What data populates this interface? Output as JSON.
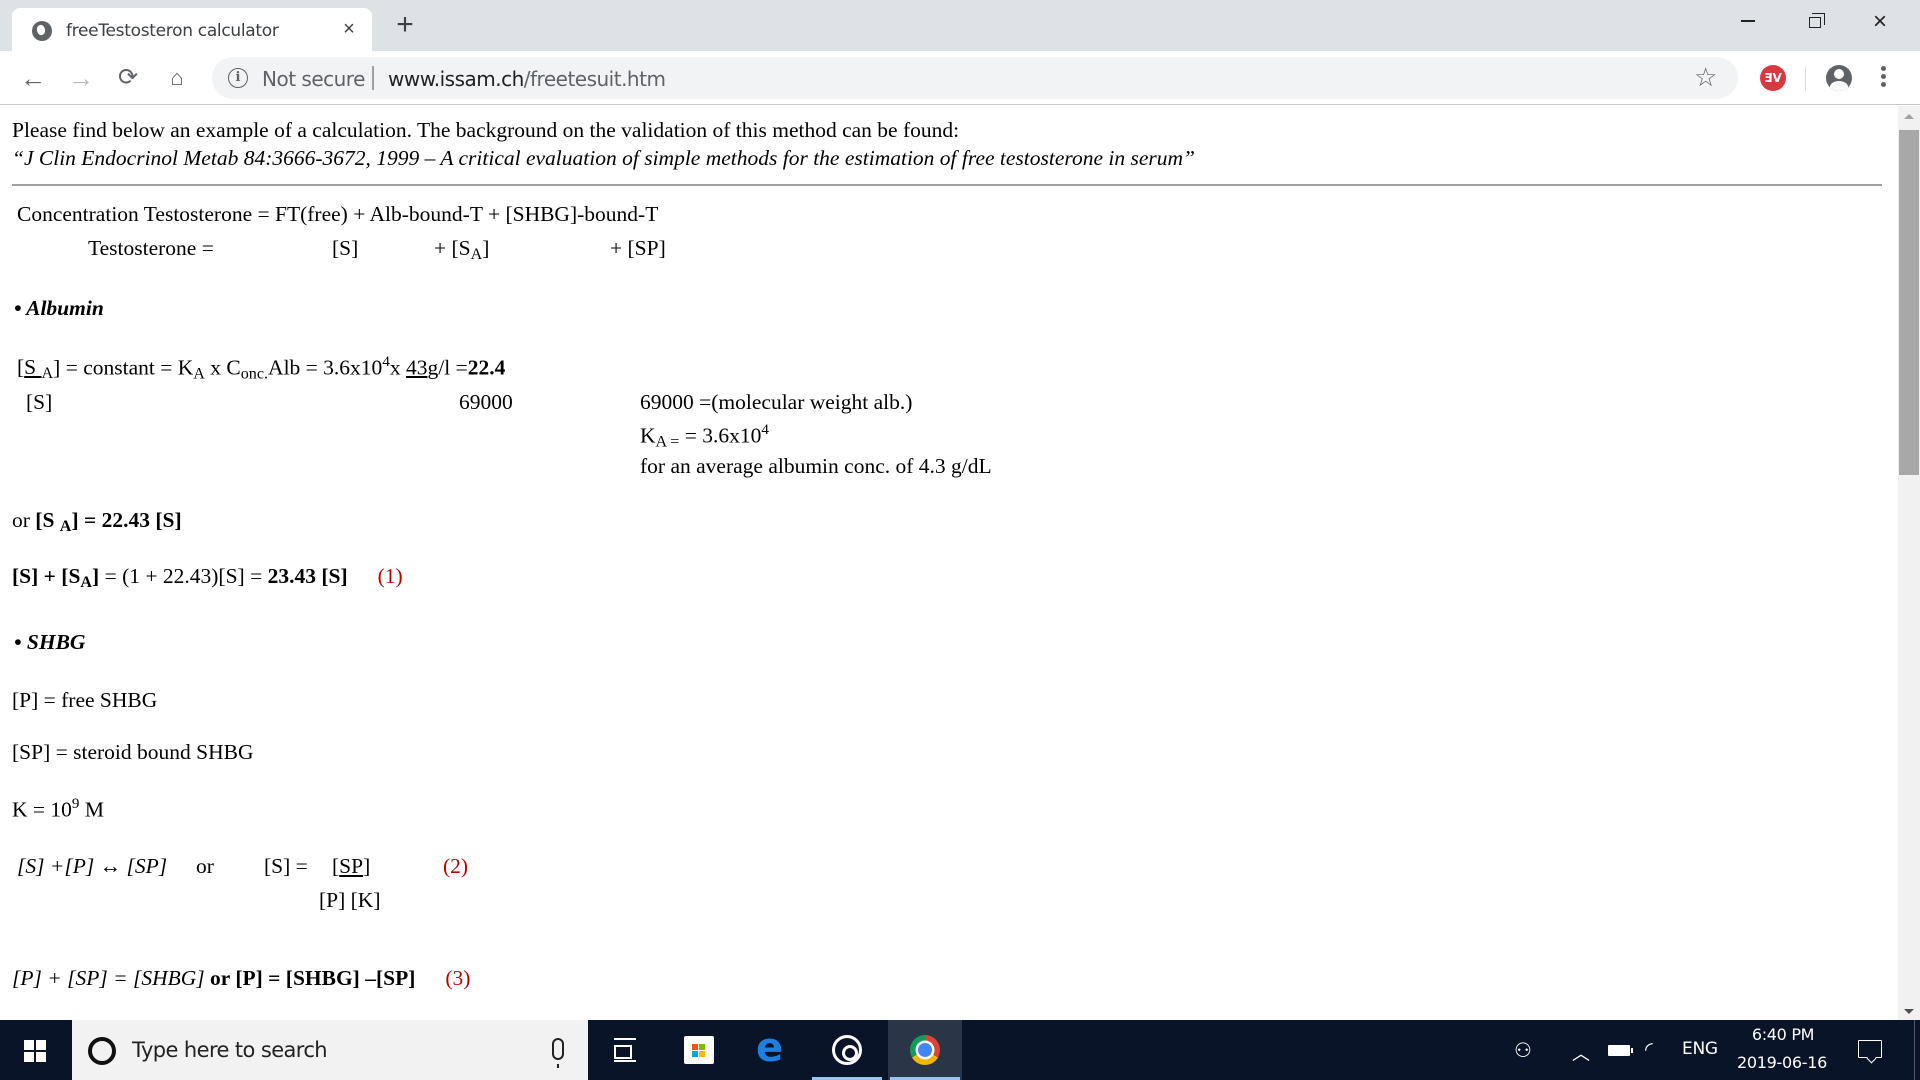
{
  "browser": {
    "tab": {
      "title": "freeTestosteron calculator",
      "close_label": "×"
    },
    "new_tab_label": "+",
    "window_controls": {
      "minimize": "minimize",
      "maximize": "restore",
      "close": "×"
    },
    "nav": {
      "back": "←",
      "forward": "→",
      "reload": "⟳",
      "home": "⌂"
    },
    "omnibox": {
      "security_icon": "info-icon",
      "security_label": "Not secure",
      "url_host": "www.issam.ch",
      "url_path": "/freetesuit.htm"
    },
    "bookmark_icon": "☆",
    "extension_label": "ƎV"
  },
  "page": {
    "intro": "Please find below an example of a calculation. The background on the validation of this method can be found:",
    "citation": "“J Clin Endocrinol Metab 84:3666-3672, 1999 – A critical evaluation of simple methods for the estimation of free testosterone in serum”",
    "eq_total": {
      "line1": "Concentration Testosterone = FT(free) + Alb-bound-T + [SHBG]-bound-T",
      "label": "Testosterone =",
      "term_s": "[S]",
      "term_sa_prefix": "+ [S",
      "term_sa_sub": "A",
      "term_sa_suffix": "]",
      "term_sp": "+ [SP]"
    },
    "albumin": {
      "heading": "Albumin",
      "bullet": "•",
      "ratio_num_prefix": "[S",
      "ratio_num_sub": "A",
      "ratio_num_suffix": "]",
      "ratio_den": "[S]",
      "eq_part1": " = constant = K",
      "ka_sub": "A",
      "eq_part2": " x C",
      "conc_sub": "onc.",
      "eq_part3": "Alb",
      "eq_part4": " = 3.6x10",
      "exp": "4",
      "eq_part5": "x ",
      "alb_num": "43",
      "alb_unit": "g/l",
      "eq_eq": " =",
      "result": "22.4",
      "mw_den": "69000",
      "note_mw": "69000 =(molecular weight alb.)",
      "note_ka_prefix": "K",
      "note_ka_sub": "A =",
      "note_ka_value": " = 3.6x10",
      "note_ka_exp": "4",
      "note_avg": "for an average albumin conc. of 4.3 g/dL",
      "or_prefix": "or ",
      "or_eq_prefix": "[S ",
      "or_eq_sub": "A",
      "or_eq_suffix": "] = 22.43 [S]",
      "sum_prefix": "[S] + [S",
      "sum_sub": "A",
      "sum_suffix": "]",
      "sum_middle": " = (1 + 22.43)[S] = ",
      "sum_result": "23.43 [S]",
      "eq_number": "(1)"
    },
    "shbg": {
      "heading": "SHBG",
      "bullet": "•",
      "def_p": "[P] = free SHBG",
      "def_sp": "[SP] = steroid bound SHBG",
      "k_prefix": "K = 10",
      "k_exp": "9",
      "k_suffix": " M",
      "reaction": "[S] +[P] ↔ [SP]",
      "or": "or",
      "s_eq": "[S] =",
      "frac_num_open": "[",
      "frac_num_inner": "SP",
      "frac_num_close": "]",
      "frac_den": "[P] [K]",
      "eq2_number": "(2)",
      "mass_balance": "[P] + [SP] = [SHBG]",
      "mass_or": " or ",
      "mass_solved": "[P] = [SHBG] –[SP]",
      "eq3_number": "(3)"
    }
  },
  "taskbar": {
    "search_placeholder": "Type here to search",
    "apps": [
      "task-view",
      "microsoft-store",
      "edge",
      "groove-music",
      "chrome"
    ],
    "tray": {
      "language": "ENG",
      "time": "6:40 PM",
      "date": "2019-06-16"
    }
  },
  "colors": {
    "equation_number": "#c00000",
    "taskbar": "#0a1428",
    "tabstrip": "#dee1e6"
  }
}
